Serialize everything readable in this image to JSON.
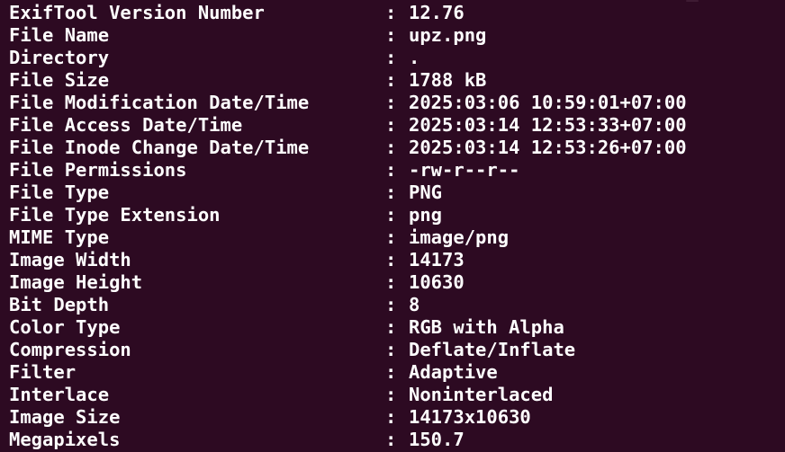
{
  "colors": {
    "background": "#2d0a22",
    "text": "#ffffff"
  },
  "separator": ":",
  "rows": [
    {
      "key": "ExifTool Version Number",
      "value": "12.76"
    },
    {
      "key": "File Name",
      "value": "upz.png"
    },
    {
      "key": "Directory",
      "value": "."
    },
    {
      "key": "File Size",
      "value": "1788 kB"
    },
    {
      "key": "File Modification Date/Time",
      "value": "2025:03:06 10:59:01+07:00"
    },
    {
      "key": "File Access Date/Time",
      "value": "2025:03:14 12:53:33+07:00"
    },
    {
      "key": "File Inode Change Date/Time",
      "value": "2025:03:14 12:53:26+07:00"
    },
    {
      "key": "File Permissions",
      "value": "-rw-r--r--"
    },
    {
      "key": "File Type",
      "value": "PNG"
    },
    {
      "key": "File Type Extension",
      "value": "png"
    },
    {
      "key": "MIME Type",
      "value": "image/png"
    },
    {
      "key": "Image Width",
      "value": "14173"
    },
    {
      "key": "Image Height",
      "value": "10630"
    },
    {
      "key": "Bit Depth",
      "value": "8"
    },
    {
      "key": "Color Type",
      "value": "RGB with Alpha"
    },
    {
      "key": "Compression",
      "value": "Deflate/Inflate"
    },
    {
      "key": "Filter",
      "value": "Adaptive"
    },
    {
      "key": "Interlace",
      "value": "Noninterlaced"
    },
    {
      "key": "Image Size",
      "value": "14173x10630"
    },
    {
      "key": "Megapixels",
      "value": "150.7"
    }
  ]
}
